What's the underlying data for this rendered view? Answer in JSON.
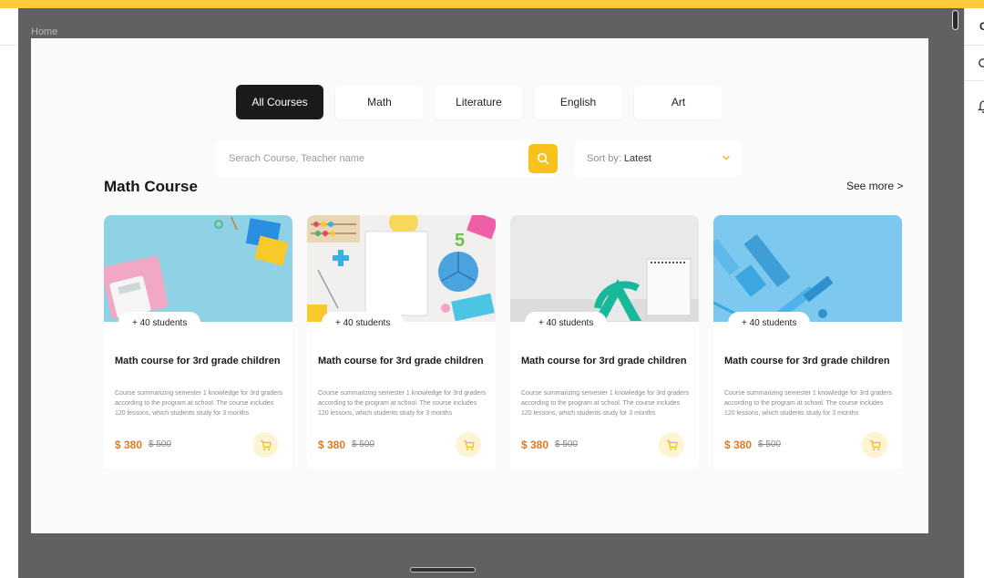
{
  "breadcrumb": "Home",
  "tabs": [
    {
      "label": "All Courses",
      "active": true
    },
    {
      "label": "Math",
      "active": false
    },
    {
      "label": "Literature",
      "active": false
    },
    {
      "label": "English",
      "active": false
    },
    {
      "label": "Art",
      "active": false
    }
  ],
  "search": {
    "placeholder": "Serach Course, Teacher name",
    "value": "",
    "icon": "search-icon"
  },
  "sort": {
    "prefix": "Sort by:",
    "value": "Latest",
    "icon": "chevron-down-icon"
  },
  "section": {
    "title": "Math Course",
    "see_more": "See more >"
  },
  "courses": [
    {
      "students": "+ 40 students",
      "title": "Math course for 3rd grade children",
      "description": "Course summarizing semester 1 knowledge for 3rd graders according to the program at school. The course includes 120 lessons, which students study for 3 months",
      "price": "$ 380",
      "old_price": "$ 500"
    },
    {
      "students": "+ 40 students",
      "title": "Math course for 3rd grade children",
      "description": "Course summarizing semester 1 knowledge for 3rd graders according to the program at school. The course includes 120 lessons, which students study for 3 months",
      "price": "$ 380",
      "old_price": "$ 500"
    },
    {
      "students": "+ 40 students",
      "title": "Math course for 3rd grade children",
      "description": "Course summarizing semester 1 knowledge for 3rd graders according to the program at school. The course includes 120 lessons, which students study for 3 months",
      "price": "$ 380",
      "old_price": "$ 500"
    },
    {
      "students": "+ 40 students",
      "title": "Math course for 3rd grade children",
      "description": "Course summarizing semester 1 knowledge for 3rd graders according to the program at school. The course includes 120 lessons, which students study for 3 months",
      "price": "$ 380",
      "old_price": "$ 500"
    }
  ],
  "colors": {
    "accent": "#f8c21c",
    "top_bar": "#fccb3a",
    "price": "#e07a22",
    "active_tab": "#1d1b19",
    "frame": "#626060"
  },
  "right_panel": {
    "text": "C"
  }
}
